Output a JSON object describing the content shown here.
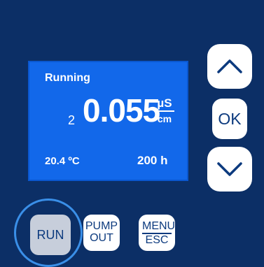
{
  "display": {
    "status": "Running",
    "channel": "2",
    "reading": "0.055",
    "unit_numerator": "µS",
    "unit_denominator": "cm",
    "temperature": "20.4 ºC",
    "hours": "200 h"
  },
  "nav": {
    "ok_label": "OK"
  },
  "buttons": {
    "run_label": "RUN",
    "pump_line1": "PUMP",
    "pump_line2": "OUT",
    "menu_line1": "MENU",
    "menu_line2": "ESC"
  },
  "colors": {
    "panel": "#0c2f66",
    "lcd": "#1268ea",
    "button_text": "#0c3a7e",
    "run_button": "#c7cedb",
    "run_ring": "#3a8fe8"
  },
  "icons": {
    "up": "chevron-up-icon",
    "down": "chevron-down-icon"
  }
}
